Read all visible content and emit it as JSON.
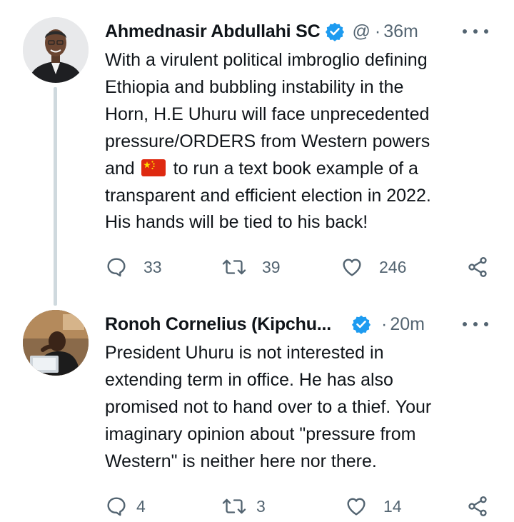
{
  "tweets": [
    {
      "author_name": "Ahmednasir Abdullahi SC",
      "handle": "@",
      "separator": "·",
      "time": "36m",
      "verified": true,
      "text_lines": [
        "With a virulent political imbroglio defining",
        "Ethiopia and bubbling instability in the",
        "Horn, H.E Uhuru will face unprecedented",
        "pressure/ORDERS from Western powers",
        [
          "and",
          "to run a text book example of a"
        ],
        "transparent and efficient election in 2022.",
        "His hands will be tied to his back!"
      ],
      "inline_emoji": "china-flag",
      "replies": "33",
      "retweets": "39",
      "likes": "246"
    },
    {
      "author_name": "Ronoh Cornelius (Kipchu...",
      "handle": "",
      "separator": "·",
      "time": "20m",
      "verified": true,
      "text_lines": [
        "President Uhuru is not interested in",
        "extending term in office. He has also",
        "promised not to hand over to a thief. Your",
        "imaginary opinion about \"pressure from",
        "Western\" is neither here nor there."
      ],
      "replies": "4",
      "retweets": "3",
      "likes": "14"
    }
  ],
  "colors": {
    "verified_blue": "#1d9bf0",
    "text": "#0f1419",
    "secondary": "#536471",
    "thread_line": "#cfd9de"
  },
  "icons": [
    "reply-icon",
    "retweet-icon",
    "like-icon",
    "share-icon",
    "more-icon",
    "verified-badge-icon"
  ]
}
